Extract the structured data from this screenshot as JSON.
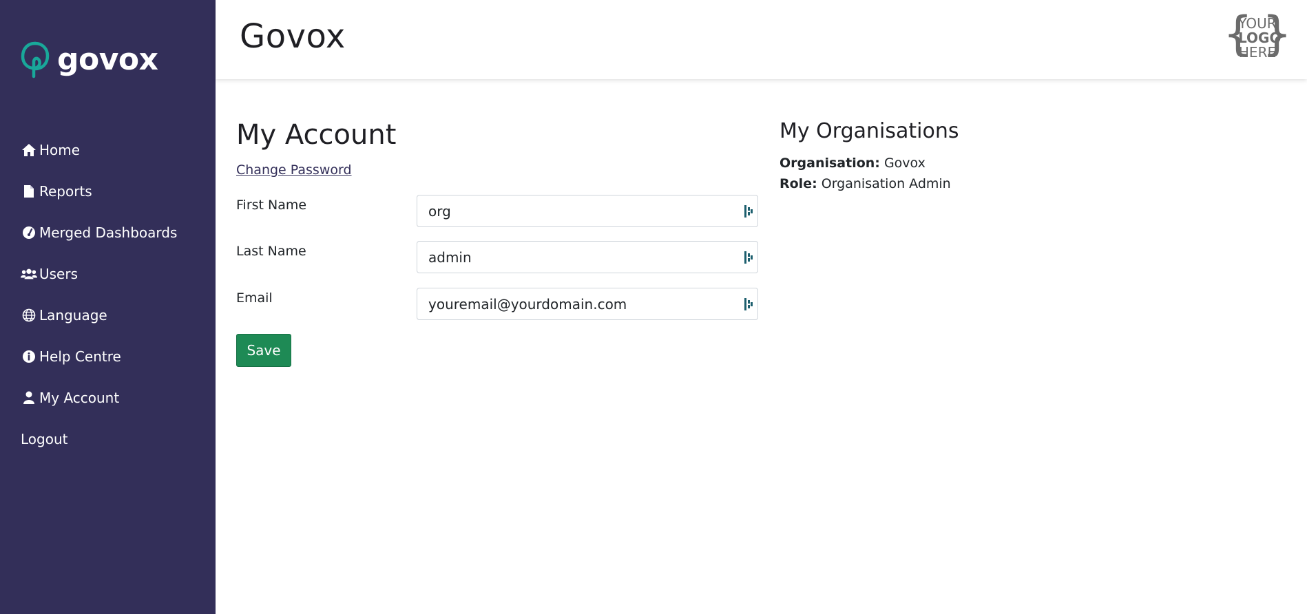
{
  "sidebar": {
    "brand": "govox",
    "brand_color": "#19a89a",
    "items": [
      {
        "label": "Home",
        "icon": "home-icon"
      },
      {
        "label": "Reports",
        "icon": "file-icon"
      },
      {
        "label": "Merged Dashboards",
        "icon": "gauge-icon"
      },
      {
        "label": "Users",
        "icon": "users-icon"
      },
      {
        "label": "Language",
        "icon": "globe-icon"
      },
      {
        "label": "Help Centre",
        "icon": "info-icon"
      },
      {
        "label": "My Account",
        "icon": "user-icon"
      },
      {
        "label": "Logout",
        "icon": ""
      }
    ]
  },
  "header": {
    "title": "Govox",
    "logo_placeholder": {
      "line1": "YOUR",
      "line2": "LOGO",
      "line3": "HERE"
    }
  },
  "account": {
    "title": "My Account",
    "change_password": "Change Password",
    "fields": {
      "first_name": {
        "label": "First Name",
        "value": "org"
      },
      "last_name": {
        "label": "Last Name",
        "value": "admin"
      },
      "email": {
        "label": "Email",
        "value": "youremail@yourdomain.com"
      }
    },
    "save_label": "Save"
  },
  "organisations": {
    "title": "My Organisations",
    "organisation_key": "Organisation:",
    "organisation_value": "Govox",
    "role_key": "Role:",
    "role_value": "Organisation Admin"
  },
  "colors": {
    "sidebar_bg": "#332f59",
    "save_button": "#1e8a55",
    "link": "#332f59"
  }
}
